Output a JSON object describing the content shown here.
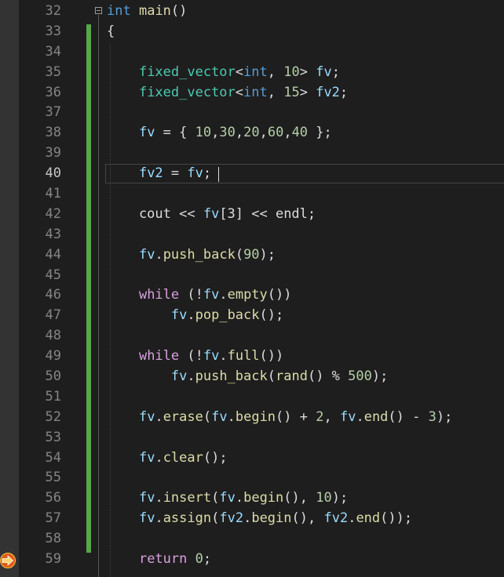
{
  "editor": {
    "active_line": "40",
    "execution_arrow_line": "59",
    "colors": {
      "background": "#1e1e1e",
      "keyword": "#569cd6",
      "control_keyword": "#d8a0df",
      "type": "#4ec9b0",
      "variable": "#9cdcfe",
      "function": "#dcdcaa",
      "number": "#b5cea8",
      "change_bar": "#57a64a",
      "line_number": "#858585"
    },
    "icons": [
      "collapse-region-icon",
      "execution-pointer-icon"
    ],
    "lines": [
      {
        "num": "32",
        "tokens": [
          {
            "t": "int",
            "c": "kw"
          },
          {
            "t": " "
          },
          {
            "t": "main",
            "c": "fn"
          },
          {
            "t": "()"
          }
        ]
      },
      {
        "num": "33",
        "tokens": [
          {
            "t": "{"
          }
        ]
      },
      {
        "num": "34",
        "tokens": []
      },
      {
        "num": "35",
        "tokens": [
          {
            "t": "    "
          },
          {
            "t": "fixed_vector",
            "c": "ty"
          },
          {
            "t": "<"
          },
          {
            "t": "int",
            "c": "kw"
          },
          {
            "t": ", "
          },
          {
            "t": "10",
            "c": "num"
          },
          {
            "t": "> "
          },
          {
            "t": "fv",
            "c": "var"
          },
          {
            "t": ";"
          }
        ]
      },
      {
        "num": "36",
        "tokens": [
          {
            "t": "    "
          },
          {
            "t": "fixed_vector",
            "c": "ty"
          },
          {
            "t": "<"
          },
          {
            "t": "int",
            "c": "kw"
          },
          {
            "t": ", "
          },
          {
            "t": "15",
            "c": "num"
          },
          {
            "t": "> "
          },
          {
            "t": "fv2",
            "c": "var"
          },
          {
            "t": ";"
          }
        ]
      },
      {
        "num": "37",
        "tokens": []
      },
      {
        "num": "38",
        "tokens": [
          {
            "t": "    "
          },
          {
            "t": "fv",
            "c": "var"
          },
          {
            "t": " = { "
          },
          {
            "t": "10",
            "c": "num"
          },
          {
            "t": ","
          },
          {
            "t": "30",
            "c": "num"
          },
          {
            "t": ","
          },
          {
            "t": "20",
            "c": "num"
          },
          {
            "t": ","
          },
          {
            "t": "60",
            "c": "num"
          },
          {
            "t": ","
          },
          {
            "t": "40",
            "c": "num"
          },
          {
            "t": " };"
          }
        ]
      },
      {
        "num": "39",
        "tokens": []
      },
      {
        "num": "40",
        "tokens": [
          {
            "t": "    "
          },
          {
            "t": "fv2",
            "c": "var"
          },
          {
            "t": " = "
          },
          {
            "t": "fv",
            "c": "var"
          },
          {
            "t": ";"
          }
        ]
      },
      {
        "num": "41",
        "tokens": []
      },
      {
        "num": "42",
        "tokens": [
          {
            "t": "    cout << "
          },
          {
            "t": "fv",
            "c": "var"
          },
          {
            "t": "[3] << endl;"
          }
        ]
      },
      {
        "num": "43",
        "tokens": []
      },
      {
        "num": "44",
        "tokens": [
          {
            "t": "    "
          },
          {
            "t": "fv",
            "c": "var"
          },
          {
            "t": "."
          },
          {
            "t": "push_back",
            "c": "fn"
          },
          {
            "t": "("
          },
          {
            "t": "90",
            "c": "num"
          },
          {
            "t": ");"
          }
        ]
      },
      {
        "num": "45",
        "tokens": []
      },
      {
        "num": "46",
        "tokens": [
          {
            "t": "    "
          },
          {
            "t": "while",
            "c": "ctl"
          },
          {
            "t": " (!"
          },
          {
            "t": "fv",
            "c": "var"
          },
          {
            "t": "."
          },
          {
            "t": "empty",
            "c": "fn"
          },
          {
            "t": "())"
          }
        ]
      },
      {
        "num": "47",
        "tokens": [
          {
            "t": "        "
          },
          {
            "t": "fv",
            "c": "var"
          },
          {
            "t": "."
          },
          {
            "t": "pop_back",
            "c": "fn"
          },
          {
            "t": "();"
          }
        ]
      },
      {
        "num": "48",
        "tokens": []
      },
      {
        "num": "49",
        "tokens": [
          {
            "t": "    "
          },
          {
            "t": "while",
            "c": "ctl"
          },
          {
            "t": " (!"
          },
          {
            "t": "fv",
            "c": "var"
          },
          {
            "t": "."
          },
          {
            "t": "full",
            "c": "fn"
          },
          {
            "t": "())"
          }
        ]
      },
      {
        "num": "50",
        "tokens": [
          {
            "t": "        "
          },
          {
            "t": "fv",
            "c": "var"
          },
          {
            "t": "."
          },
          {
            "t": "push_back",
            "c": "fn"
          },
          {
            "t": "("
          },
          {
            "t": "rand",
            "c": "fn"
          },
          {
            "t": "() % "
          },
          {
            "t": "500",
            "c": "num"
          },
          {
            "t": ");"
          }
        ]
      },
      {
        "num": "51",
        "tokens": []
      },
      {
        "num": "52",
        "tokens": [
          {
            "t": "    "
          },
          {
            "t": "fv",
            "c": "var"
          },
          {
            "t": "."
          },
          {
            "t": "erase",
            "c": "fn"
          },
          {
            "t": "("
          },
          {
            "t": "fv",
            "c": "var"
          },
          {
            "t": "."
          },
          {
            "t": "begin",
            "c": "fn"
          },
          {
            "t": "() + "
          },
          {
            "t": "2",
            "c": "num"
          },
          {
            "t": ", "
          },
          {
            "t": "fv",
            "c": "var"
          },
          {
            "t": "."
          },
          {
            "t": "end",
            "c": "fn"
          },
          {
            "t": "() - "
          },
          {
            "t": "3",
            "c": "num"
          },
          {
            "t": ");"
          }
        ]
      },
      {
        "num": "53",
        "tokens": []
      },
      {
        "num": "54",
        "tokens": [
          {
            "t": "    "
          },
          {
            "t": "fv",
            "c": "var"
          },
          {
            "t": "."
          },
          {
            "t": "clear",
            "c": "fn"
          },
          {
            "t": "();"
          }
        ]
      },
      {
        "num": "55",
        "tokens": []
      },
      {
        "num": "56",
        "tokens": [
          {
            "t": "    "
          },
          {
            "t": "fv",
            "c": "var"
          },
          {
            "t": "."
          },
          {
            "t": "insert",
            "c": "fn"
          },
          {
            "t": "("
          },
          {
            "t": "fv",
            "c": "var"
          },
          {
            "t": "."
          },
          {
            "t": "begin",
            "c": "fn"
          },
          {
            "t": "(), "
          },
          {
            "t": "10",
            "c": "num"
          },
          {
            "t": ");"
          }
        ]
      },
      {
        "num": "57",
        "tokens": [
          {
            "t": "    "
          },
          {
            "t": "fv",
            "c": "var"
          },
          {
            "t": "."
          },
          {
            "t": "assign",
            "c": "fn"
          },
          {
            "t": "("
          },
          {
            "t": "fv2",
            "c": "var"
          },
          {
            "t": "."
          },
          {
            "t": "begin",
            "c": "fn"
          },
          {
            "t": "(), "
          },
          {
            "t": "fv2",
            "c": "var"
          },
          {
            "t": "."
          },
          {
            "t": "end",
            "c": "fn"
          },
          {
            "t": "());"
          }
        ]
      },
      {
        "num": "58",
        "tokens": []
      },
      {
        "num": "59",
        "tokens": [
          {
            "t": "    "
          },
          {
            "t": "return",
            "c": "ctl"
          },
          {
            "t": " "
          },
          {
            "t": "0",
            "c": "num"
          },
          {
            "t": ";"
          }
        ]
      }
    ]
  }
}
